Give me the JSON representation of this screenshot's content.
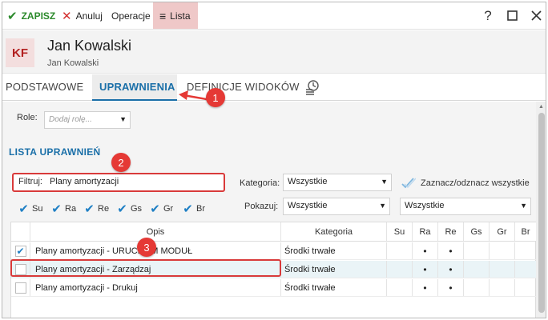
{
  "toolbar": {
    "save_label": "ZAPISZ",
    "cancel_label": "Anuluj",
    "operations_label": "Operacje",
    "list_label": "Lista",
    "help_label": "?"
  },
  "header": {
    "avatar_initials": "KF",
    "name": "Jan Kowalski",
    "subname": "Jan Kowalski"
  },
  "tabs": [
    {
      "label": "PODSTAWOWE"
    },
    {
      "label": "UPRAWNIENIA"
    },
    {
      "label": "DEFINICJE WIDOKÓW"
    }
  ],
  "roles": {
    "label": "Role:",
    "placeholder": "Dodaj rolę..."
  },
  "section_title": "LISTA UPRAWNIEŃ",
  "filter": {
    "label": "Filtruj:",
    "value": "Plany amortyzacji"
  },
  "kategoria": {
    "label": "Kategoria:",
    "value": "Wszystkie"
  },
  "toggle_all_label": "Zaznacz/odznacz wszystkie",
  "pokazuj": {
    "label": "Pokazuj:",
    "value": "Wszystkie",
    "second_value": "Wszystkie"
  },
  "column_checks": [
    {
      "label": "Su"
    },
    {
      "label": "Ra"
    },
    {
      "label": "Re"
    },
    {
      "label": "Gs"
    },
    {
      "label": "Gr"
    },
    {
      "label": "Br"
    }
  ],
  "table": {
    "headers": {
      "opis": "Opis",
      "kategoria": "Kategoria",
      "su": "Su",
      "ra": "Ra",
      "re": "Re",
      "gs": "Gs",
      "gr": "Gr",
      "br": "Br"
    },
    "rows": [
      {
        "opis": "Plany amortyzacji - URUCHOM MODUŁ",
        "kategoria": "Środki trwałe",
        "checked": true
      },
      {
        "opis": "Plany amortyzacji - Zarządzaj",
        "kategoria": "Środki trwałe",
        "checked": false
      },
      {
        "opis": "Plany amortyzacji - Drukuj",
        "kategoria": "Środki trwałe",
        "checked": false
      }
    ],
    "dot": "•",
    "check": "✔"
  },
  "annotations": {
    "badge1": "1",
    "badge2": "2",
    "badge3": "3"
  },
  "colors": {
    "accent": "#1a6fa8",
    "save": "#2c8a2c",
    "highlight": "#d93a3a",
    "list_bg": "#efc8c8"
  }
}
